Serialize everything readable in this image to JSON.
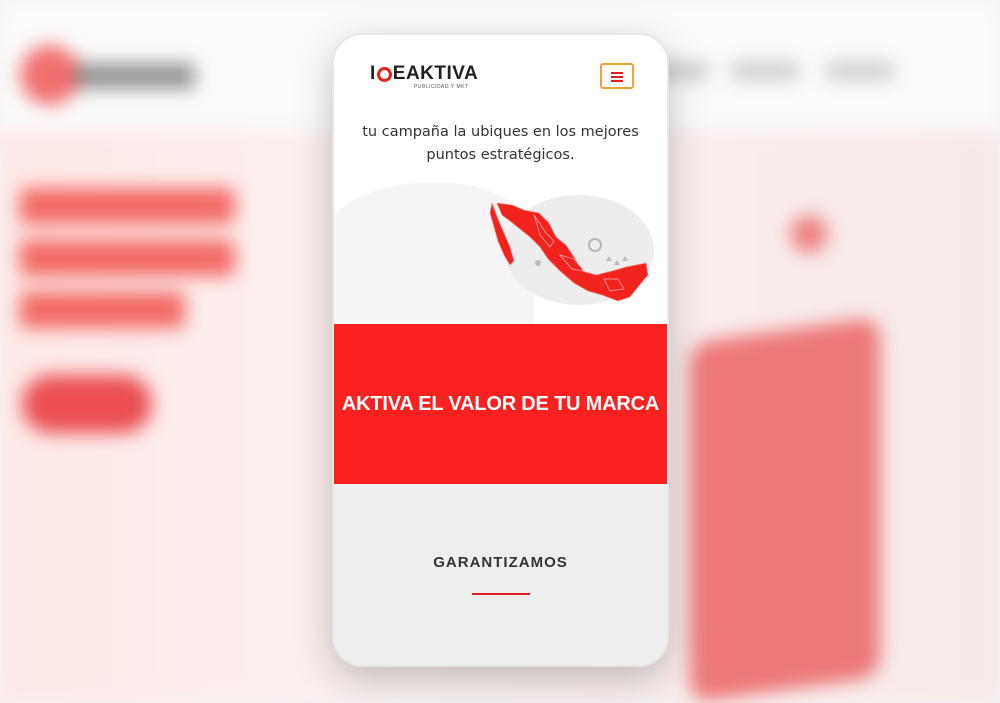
{
  "brand": {
    "name_before": "I",
    "name_after": "EAKTIVA",
    "tagline": "PUBLICIDAD Y MKT",
    "accent_color": "#fb2120"
  },
  "header": {
    "menu_icon": "hamburger-menu-icon"
  },
  "intro": {
    "line1": "tu campaña la ubiques en los mejores",
    "line2": "puntos estratégicos."
  },
  "map": {
    "icon": "mexico-map-illustration"
  },
  "banner": {
    "title": "AKTIVA EL VALOR DE TU MARCA"
  },
  "section": {
    "title": "GARANTIZAMOS"
  }
}
